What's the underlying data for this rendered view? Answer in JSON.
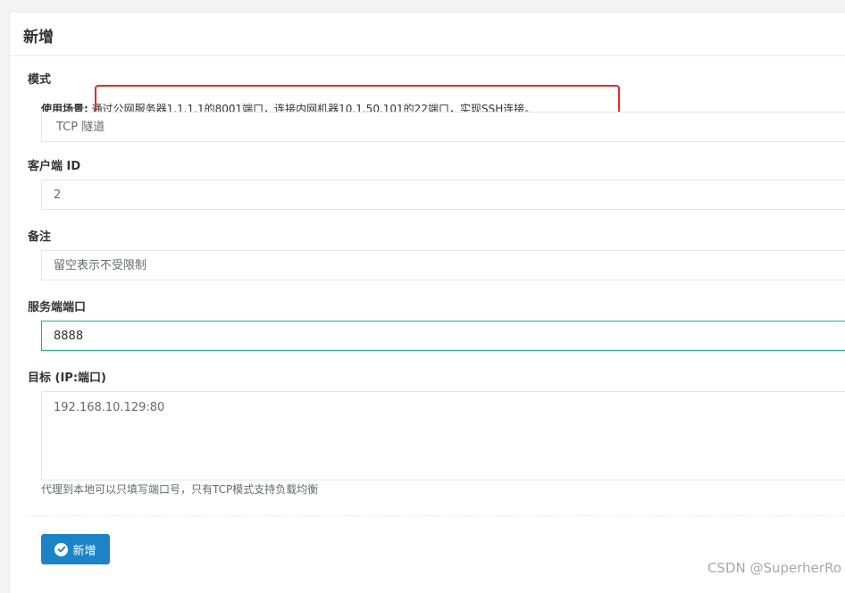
{
  "panel": {
    "title": "新增"
  },
  "mode": {
    "label": "模式",
    "scenario_label": "使用场景:",
    "scenario_text": "通过公网服务器1.1.1.1的8001端口，连接内网机器10.1.50.101的22端口，实现SSH连接。",
    "selected": "TCP 隧道"
  },
  "client_id": {
    "label": "客户端 ID",
    "value": "2"
  },
  "remark": {
    "label": "备注",
    "placeholder": "留空表示不受限制"
  },
  "server_port": {
    "label": "服务端端口",
    "value": "8888"
  },
  "target": {
    "label": "目标 (IP:端口)",
    "value": "192.168.10.129:80",
    "help": "代理到本地可以只填写端口号，只有TCP模式支持负载均衡"
  },
  "submit": {
    "label": "新增",
    "icon": "check-circle-icon"
  },
  "watermark": "CSDN @SuperherRo",
  "colors": {
    "primary": "#1c84c6",
    "focus_border": "#1ab394",
    "annotation": "#e02b27"
  }
}
